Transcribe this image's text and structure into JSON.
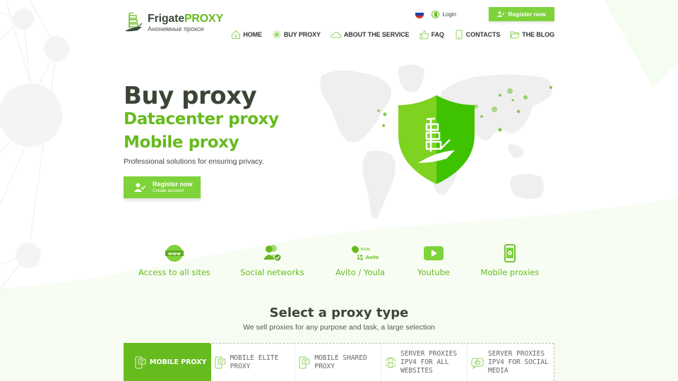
{
  "brand": {
    "name_main": "Frigate",
    "name_accent": "PROXY",
    "tagline": "Анонимные прокси",
    "accent_color": "#66bb1e",
    "button_color": "#7ed33a"
  },
  "topbar": {
    "language": "ru",
    "login_label": "Login",
    "register_label": "Register now"
  },
  "nav": {
    "items": [
      {
        "label": "HOME",
        "icon": "home-icon"
      },
      {
        "label": "BUY PROXY",
        "icon": "network-icon"
      },
      {
        "label": "ABOUT THE SERVICE",
        "icon": "cloud-icon"
      },
      {
        "label": "FAQ",
        "icon": "thumbs-up-icon"
      },
      {
        "label": "CONTACTS",
        "icon": "phone-icon"
      },
      {
        "label": "THE BLOG",
        "icon": "folder-icon"
      }
    ]
  },
  "hero": {
    "title": "Buy proxy",
    "subtitle1": "Datacenter proxy",
    "subtitle2": "Mobile proxy",
    "description": "Professional solutions for ensuring privacy.",
    "button_title": "Register now",
    "button_subtitle": "Create account"
  },
  "features": [
    {
      "label": "Access to all sites",
      "icon": "www-globe-icon"
    },
    {
      "label": "Social networks",
      "icon": "users-check-icon"
    },
    {
      "label": "Avito / Youla",
      "icon": "avito-youla-icon",
      "logo_top": "юла",
      "logo_bottom": "Avito"
    },
    {
      "label": "Youtube",
      "icon": "youtube-icon"
    },
    {
      "label": "Mobile proxies",
      "icon": "mobile-gear-icon"
    }
  ],
  "select_section": {
    "title": "Select a proxy type",
    "subtitle": "We sell proxies for any purpose and task, a large selection",
    "tabs": [
      {
        "label": "MOBILE PROXY",
        "active": true,
        "icon": "mobile-chat-icon"
      },
      {
        "label": "MOBILE ELITE PROXY",
        "active": false,
        "icon": "mobile-chat-icon"
      },
      {
        "label": "MOBILE SHARED PROXY",
        "active": false,
        "icon": "mobile-chat-icon"
      },
      {
        "label": "SERVER PROXIES IPV4 FOR ALL WEBSITES",
        "active": false,
        "icon": "www-globe-icon"
      },
      {
        "label": "SERVER PROXIES IPV4 FOR SOCIAL MEDIA",
        "active": false,
        "icon": "thumbs-up-chat-icon"
      }
    ]
  }
}
